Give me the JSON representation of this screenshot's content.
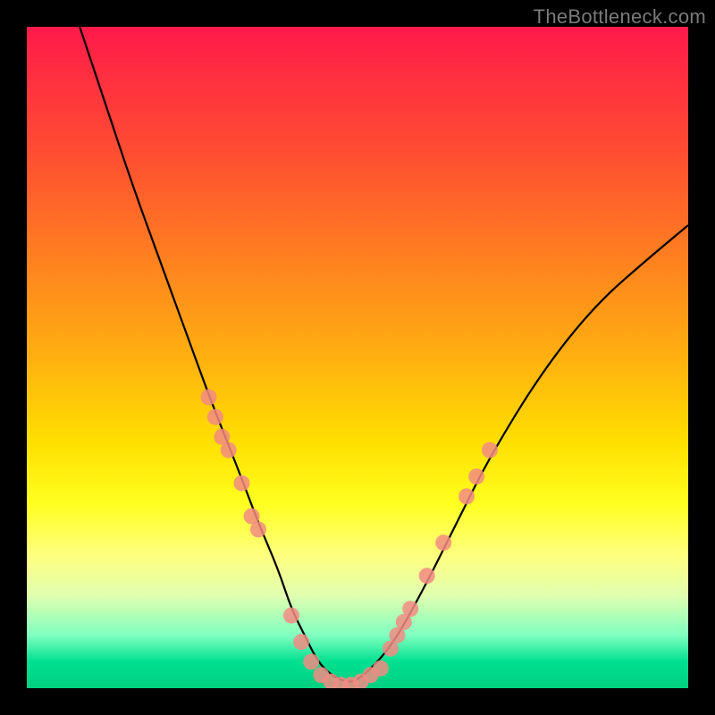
{
  "watermark": "TheBottleneck.com",
  "chart_data": {
    "type": "line",
    "title": "",
    "xlabel": "",
    "ylabel": "",
    "xlim": [
      0,
      100
    ],
    "ylim": [
      0,
      100
    ],
    "series": [
      {
        "name": "curve",
        "x": [
          8,
          12,
          16,
          20,
          24,
          28,
          32,
          35,
          38,
          40,
          42,
          44,
          46,
          48,
          50,
          55,
          60,
          65,
          70,
          78,
          86,
          94,
          100
        ],
        "y": [
          100,
          88,
          76,
          65,
          54,
          43,
          33,
          25,
          18,
          12,
          8,
          4,
          2,
          1,
          1,
          6,
          15,
          25,
          35,
          48,
          58,
          65,
          70
        ]
      }
    ],
    "points_left": [
      {
        "x": 27.5,
        "y": 44
      },
      {
        "x": 28.5,
        "y": 41
      },
      {
        "x": 29.5,
        "y": 38
      },
      {
        "x": 30.5,
        "y": 36
      },
      {
        "x": 32.5,
        "y": 31
      },
      {
        "x": 34.0,
        "y": 26
      },
      {
        "x": 35.0,
        "y": 24
      }
    ],
    "points_right": [
      {
        "x": 53.5,
        "y": 3
      },
      {
        "x": 55.0,
        "y": 6
      },
      {
        "x": 56.0,
        "y": 8
      },
      {
        "x": 57.0,
        "y": 10
      },
      {
        "x": 58.0,
        "y": 12
      },
      {
        "x": 60.5,
        "y": 17
      },
      {
        "x": 63.0,
        "y": 22
      },
      {
        "x": 66.5,
        "y": 29
      },
      {
        "x": 68.0,
        "y": 32
      },
      {
        "x": 70.0,
        "y": 36
      }
    ],
    "points_bottom": [
      {
        "x": 40.0,
        "y": 11
      },
      {
        "x": 41.5,
        "y": 7
      },
      {
        "x": 43.0,
        "y": 4
      },
      {
        "x": 44.5,
        "y": 2
      },
      {
        "x": 46.0,
        "y": 1
      },
      {
        "x": 47.5,
        "y": 0.5
      },
      {
        "x": 49.0,
        "y": 0.5
      },
      {
        "x": 50.5,
        "y": 1
      },
      {
        "x": 52.0,
        "y": 2
      }
    ]
  }
}
